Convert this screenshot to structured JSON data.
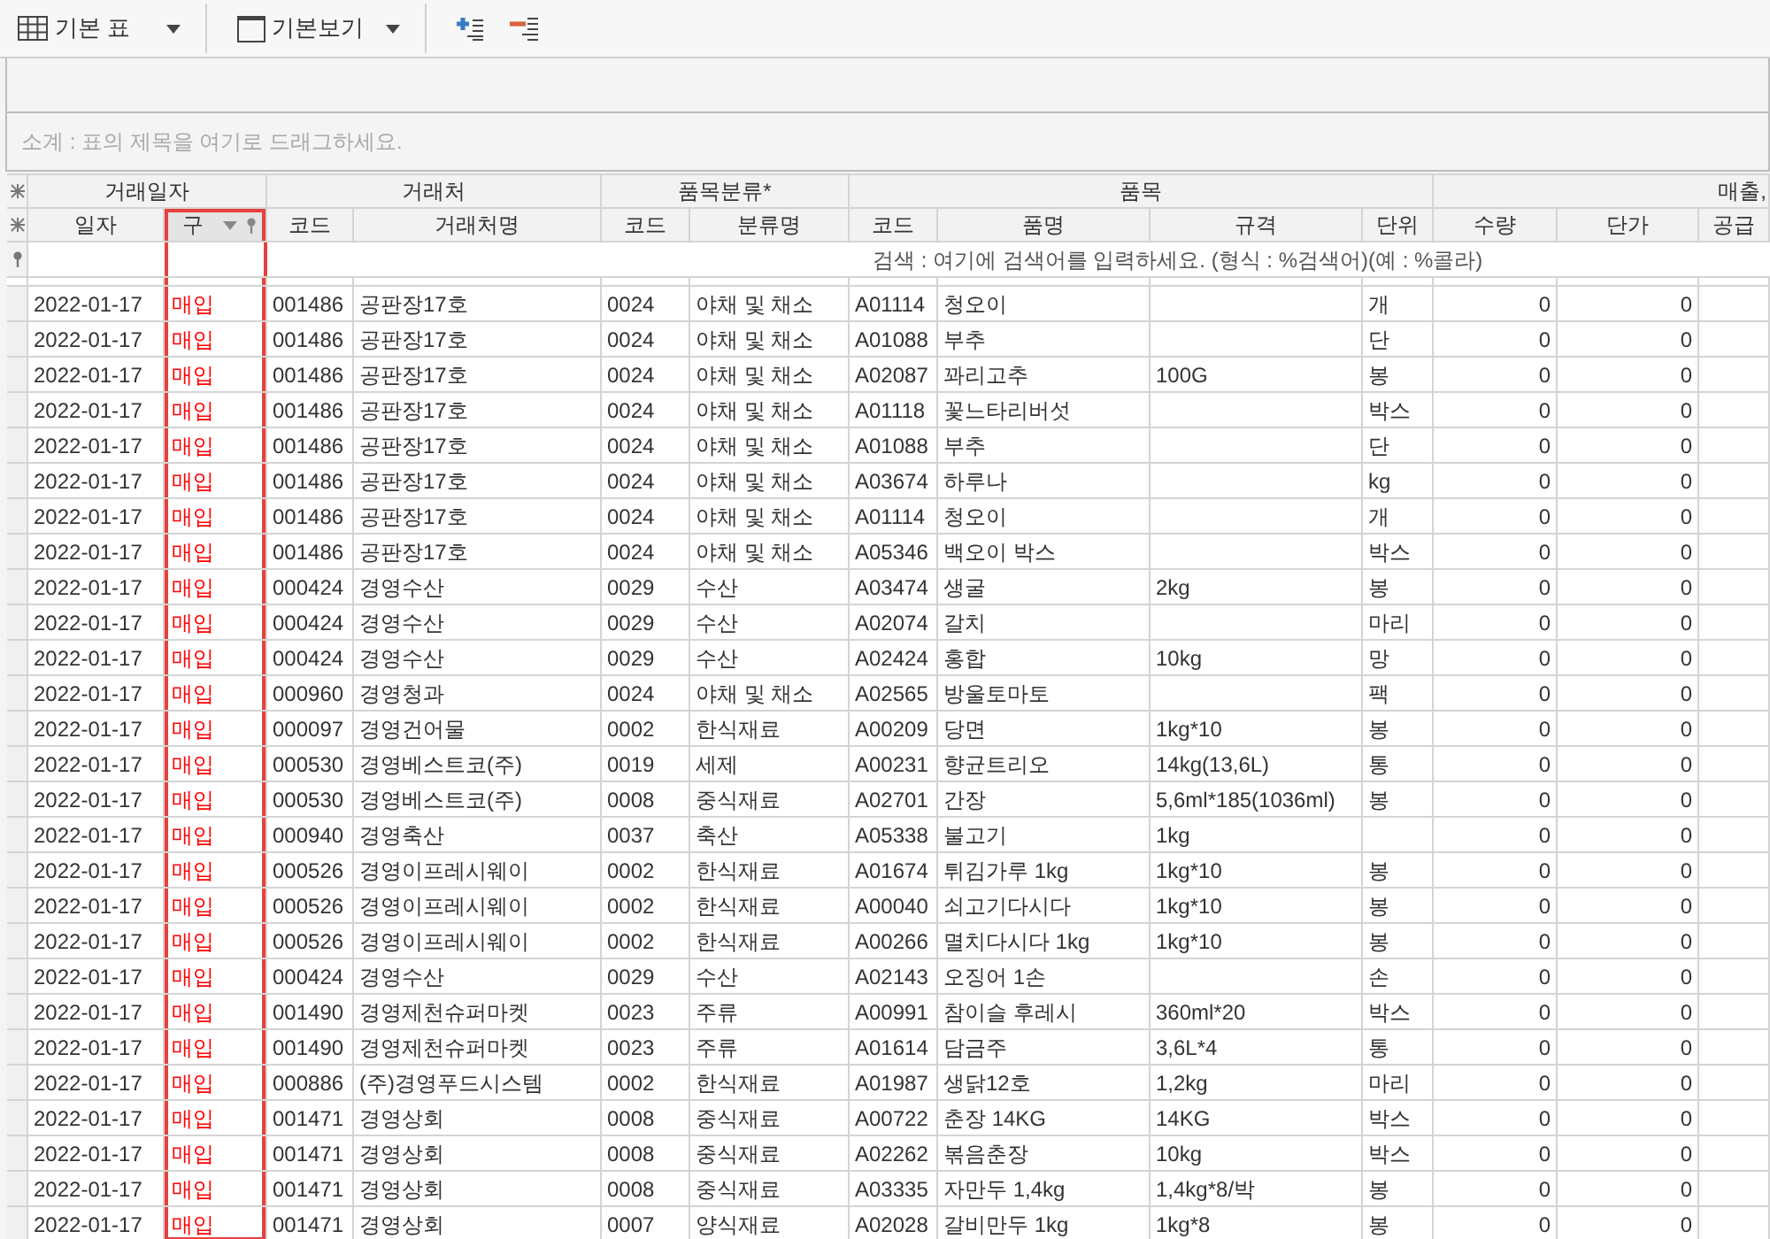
{
  "toolbar": {
    "view_menu": {
      "label": "기본 표"
    },
    "layout_menu": {
      "label": "기본보기"
    }
  },
  "group_panel": {
    "hint": "소계 : 표의 제목을 여기로 드래그하세요."
  },
  "grid": {
    "groups": [
      {
        "label": "거래일자",
        "columns": [
          {
            "label": "일자",
            "selected": false
          },
          {
            "label": "구",
            "selected": true
          }
        ]
      },
      {
        "label": "거래처",
        "columns": [
          {
            "label": "코드",
            "selected": false
          },
          {
            "label": "거래처명",
            "selected": false
          }
        ]
      },
      {
        "label": "품목분류*",
        "columns": [
          {
            "label": "코드",
            "selected": false
          },
          {
            "label": "분류명",
            "selected": false
          }
        ]
      },
      {
        "label": "품목",
        "columns": [
          {
            "label": "코드",
            "selected": false
          },
          {
            "label": "품명",
            "selected": false
          },
          {
            "label": "규격",
            "selected": false
          },
          {
            "label": "단위",
            "selected": false
          }
        ]
      },
      {
        "label": "매출,",
        "columns": [
          {
            "label": "수량",
            "selected": false
          },
          {
            "label": "단가",
            "selected": false
          },
          {
            "label": "공급",
            "selected": false
          }
        ]
      }
    ],
    "search": {
      "placeholder": "검색 : 여기에 검색어를 입력하세요. (형식 : %검색어)(예 : %콜라)"
    },
    "rows": [
      {
        "date": "2022-01-17",
        "type": "매입",
        "partner_code": "001486",
        "partner_name": "공판장17호",
        "category_code": "0024",
        "category_name": "야채 및 채소",
        "item_code": "A01114",
        "item_name": "청오이",
        "unit": "개",
        "quantity": "0",
        "unit_price": "0"
      },
      {
        "date": "2022-01-17",
        "type": "매입",
        "partner_code": "001486",
        "partner_name": "공판장17호",
        "category_code": "0024",
        "category_name": "야채 및 채소",
        "item_code": "A01088",
        "item_name": "부추",
        "unit": "단",
        "quantity": "0",
        "unit_price": "0"
      },
      {
        "date": "2022-01-17",
        "type": "매입",
        "partner_code": "001486",
        "partner_name": "공판장17호",
        "category_code": "0024",
        "category_name": "야채 및 채소",
        "item_code": "A02087",
        "item_name": "꽈리고추",
        "spec": "100G",
        "unit": "봉",
        "quantity": "0",
        "unit_price": "0"
      },
      {
        "date": "2022-01-17",
        "type": "매입",
        "partner_code": "001486",
        "partner_name": "공판장17호",
        "category_code": "0024",
        "category_name": "야채 및 채소",
        "item_code": "A01118",
        "item_name": "꽃느타리버섯",
        "unit": "박스",
        "quantity": "0",
        "unit_price": "0"
      },
      {
        "date": "2022-01-17",
        "type": "매입",
        "partner_code": "001486",
        "partner_name": "공판장17호",
        "category_code": "0024",
        "category_name": "야채 및 채소",
        "item_code": "A01088",
        "item_name": "부추",
        "unit": "단",
        "quantity": "0",
        "unit_price": "0"
      },
      {
        "date": "2022-01-17",
        "type": "매입",
        "partner_code": "001486",
        "partner_name": "공판장17호",
        "category_code": "0024",
        "category_name": "야채 및 채소",
        "item_code": "A03674",
        "item_name": "하루나",
        "unit": "kg",
        "quantity": "0",
        "unit_price": "0"
      },
      {
        "date": "2022-01-17",
        "type": "매입",
        "partner_code": "001486",
        "partner_name": "공판장17호",
        "category_code": "0024",
        "category_name": "야채 및 채소",
        "item_code": "A01114",
        "item_name": "청오이",
        "unit": "개",
        "quantity": "0",
        "unit_price": "0"
      },
      {
        "date": "2022-01-17",
        "type": "매입",
        "partner_code": "001486",
        "partner_name": "공판장17호",
        "category_code": "0024",
        "category_name": "야채 및 채소",
        "item_code": "A05346",
        "item_name": "백오이 박스",
        "unit": "박스",
        "quantity": "0",
        "unit_price": "0"
      },
      {
        "date": "2022-01-17",
        "type": "매입",
        "partner_code": "000424",
        "partner_name": "경영수산",
        "category_code": "0029",
        "category_name": "수산",
        "item_code": "A03474",
        "item_name": "생굴",
        "spec": "2kg",
        "unit": "봉",
        "quantity": "0",
        "unit_price": "0"
      },
      {
        "date": "2022-01-17",
        "type": "매입",
        "partner_code": "000424",
        "partner_name": "경영수산",
        "category_code": "0029",
        "category_name": "수산",
        "item_code": "A02074",
        "item_name": "갈치",
        "unit": "마리",
        "quantity": "0",
        "unit_price": "0"
      },
      {
        "date": "2022-01-17",
        "type": "매입",
        "partner_code": "000424",
        "partner_name": "경영수산",
        "category_code": "0029",
        "category_name": "수산",
        "item_code": "A02424",
        "item_name": "홍합",
        "spec": "10kg",
        "unit": "망",
        "quantity": "0",
        "unit_price": "0"
      },
      {
        "date": "2022-01-17",
        "type": "매입",
        "partner_code": "000960",
        "partner_name": "경영청과",
        "category_code": "0024",
        "category_name": "야채 및 채소",
        "item_code": "A02565",
        "item_name": "방울토마토",
        "unit": "팩",
        "quantity": "0",
        "unit_price": "0"
      },
      {
        "date": "2022-01-17",
        "type": "매입",
        "partner_code": "000097",
        "partner_name": "경영건어물",
        "category_code": "0002",
        "category_name": "한식재료",
        "item_code": "A00209",
        "item_name": "당면",
        "spec": "1kg*10",
        "unit": "봉",
        "quantity": "0",
        "unit_price": "0"
      },
      {
        "date": "2022-01-17",
        "type": "매입",
        "partner_code": "000530",
        "partner_name": "경영베스트코(주)",
        "category_code": "0019",
        "category_name": "세제",
        "item_code": "A00231",
        "item_name": "향균트리오",
        "spec": "14kg(13,6L)",
        "unit": "통",
        "quantity": "0",
        "unit_price": "0"
      },
      {
        "date": "2022-01-17",
        "type": "매입",
        "partner_code": "000530",
        "partner_name": "경영베스트코(주)",
        "category_code": "0008",
        "category_name": "중식재료",
        "item_code": "A02701",
        "item_name": "간장",
        "spec": "5,6ml*185(1036ml)",
        "unit": "봉",
        "quantity": "0",
        "unit_price": "0"
      },
      {
        "date": "2022-01-17",
        "type": "매입",
        "partner_code": "000940",
        "partner_name": "경영축산",
        "category_code": "0037",
        "category_name": "축산",
        "item_code": "A05338",
        "item_name": "불고기",
        "spec": "1kg",
        "quantity": "0",
        "unit_price": "0"
      },
      {
        "date": "2022-01-17",
        "type": "매입",
        "partner_code": "000526",
        "partner_name": "경영이프레시웨이",
        "category_code": "0002",
        "category_name": "한식재료",
        "item_code": "A01674",
        "item_name": "튀김가루 1kg",
        "spec": "1kg*10",
        "unit": "봉",
        "quantity": "0",
        "unit_price": "0"
      },
      {
        "date": "2022-01-17",
        "type": "매입",
        "partner_code": "000526",
        "partner_name": "경영이프레시웨이",
        "category_code": "0002",
        "category_name": "한식재료",
        "item_code": "A00040",
        "item_name": "쇠고기다시다",
        "spec": "1kg*10",
        "unit": "봉",
        "quantity": "0",
        "unit_price": "0"
      },
      {
        "date": "2022-01-17",
        "type": "매입",
        "partner_code": "000526",
        "partner_name": "경영이프레시웨이",
        "category_code": "0002",
        "category_name": "한식재료",
        "item_code": "A00266",
        "item_name": "멸치다시다 1kg",
        "spec": "1kg*10",
        "unit": "봉",
        "quantity": "0",
        "unit_price": "0"
      },
      {
        "date": "2022-01-17",
        "type": "매입",
        "partner_code": "000424",
        "partner_name": "경영수산",
        "category_code": "0029",
        "category_name": "수산",
        "item_code": "A02143",
        "item_name": "오징어 1손",
        "unit": "손",
        "quantity": "0",
        "unit_price": "0"
      },
      {
        "date": "2022-01-17",
        "type": "매입",
        "partner_code": "001490",
        "partner_name": "경영제천슈퍼마켓",
        "category_code": "0023",
        "category_name": "주류",
        "item_code": "A00991",
        "item_name": "참이슬 후레시",
        "spec": "360ml*20",
        "unit": "박스",
        "quantity": "0",
        "unit_price": "0"
      },
      {
        "date": "2022-01-17",
        "type": "매입",
        "partner_code": "001490",
        "partner_name": "경영제천슈퍼마켓",
        "category_code": "0023",
        "category_name": "주류",
        "item_code": "A01614",
        "item_name": "담금주",
        "spec": "3,6L*4",
        "unit": "통",
        "quantity": "0",
        "unit_price": "0"
      },
      {
        "date": "2022-01-17",
        "type": "매입",
        "partner_code": "000886",
        "partner_name": "(주)경영푸드시스템",
        "category_code": "0002",
        "category_name": "한식재료",
        "item_code": "A01987",
        "item_name": "생닭12호",
        "spec": "1,2kg",
        "unit": "마리",
        "quantity": "0",
        "unit_price": "0"
      },
      {
        "date": "2022-01-17",
        "type": "매입",
        "partner_code": "001471",
        "partner_name": "경영상회",
        "category_code": "0008",
        "category_name": "중식재료",
        "item_code": "A00722",
        "item_name": "춘장 14KG",
        "spec": "14KG",
        "unit": "박스",
        "quantity": "0",
        "unit_price": "0"
      },
      {
        "date": "2022-01-17",
        "type": "매입",
        "partner_code": "001471",
        "partner_name": "경영상회",
        "category_code": "0008",
        "category_name": "중식재료",
        "item_code": "A02262",
        "item_name": "볶음춘장",
        "spec": "10kg",
        "unit": "박스",
        "quantity": "0",
        "unit_price": "0"
      },
      {
        "date": "2022-01-17",
        "type": "매입",
        "partner_code": "001471",
        "partner_name": "경영상회",
        "category_code": "0008",
        "category_name": "중식재료",
        "item_code": "A03335",
        "item_name": "자만두 1,4kg",
        "spec": "1,4kg*8/박",
        "unit": "봉",
        "quantity": "0",
        "unit_price": "0"
      },
      {
        "date": "2022-01-17",
        "type": "매입",
        "partner_code": "001471",
        "partner_name": "경영상회",
        "category_code": "0007",
        "category_name": "양식재료",
        "item_code": "A02028",
        "item_name": "갈비만두 1kg",
        "spec": "1kg*8",
        "unit": "봉",
        "quantity": "0",
        "unit_price": "0"
      }
    ]
  }
}
